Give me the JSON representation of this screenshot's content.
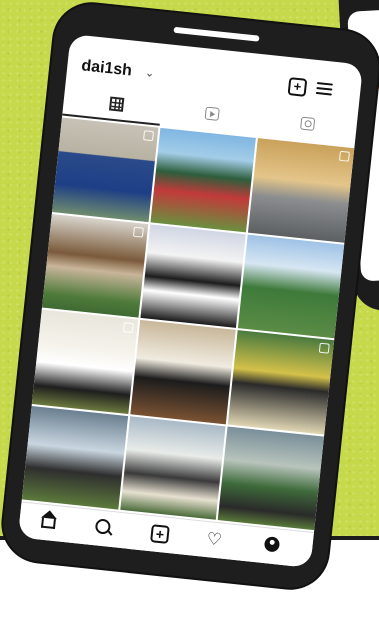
{
  "profile": {
    "username": "dai1sh",
    "switch_icon": "chevron-down-icon"
  },
  "header_actions": [
    {
      "icon": "new-post-icon"
    },
    {
      "icon": "menu-icon"
    }
  ],
  "tabs": [
    {
      "icon": "grid-icon",
      "active": true
    },
    {
      "icon": "reels-icon",
      "active": false
    },
    {
      "icon": "tagged-icon",
      "active": false
    }
  ],
  "posts": [
    {
      "subject": "photo-post",
      "multi": true
    },
    {
      "subject": "photo-post",
      "multi": false
    },
    {
      "subject": "photo-post",
      "multi": true
    },
    {
      "subject": "photo-post",
      "multi": true
    },
    {
      "subject": "photo-post",
      "multi": false
    },
    {
      "subject": "photo-post",
      "multi": false
    },
    {
      "subject": "photo-post",
      "multi": true
    },
    {
      "subject": "photo-post",
      "multi": false
    },
    {
      "subject": "photo-post",
      "multi": true
    },
    {
      "subject": "photo-post",
      "multi": false
    },
    {
      "subject": "photo-post",
      "multi": false
    },
    {
      "subject": "photo-post",
      "multi": false
    }
  ],
  "bottom_nav": [
    {
      "icon": "home-icon"
    },
    {
      "icon": "search-icon"
    },
    {
      "icon": "create-icon"
    },
    {
      "icon": "activity-heart-icon"
    },
    {
      "icon": "profile-icon"
    }
  ],
  "colors": {
    "background": "#c5d94a",
    "phone_frame": "#1e1e1e",
    "screen": "#ffffff"
  }
}
